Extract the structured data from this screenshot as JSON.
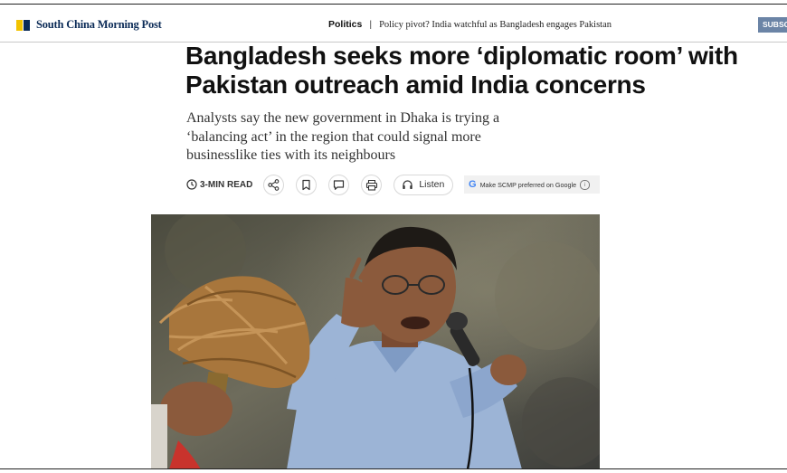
{
  "header": {
    "brand": "South China Morning Post",
    "section": "Politics",
    "separator": "|",
    "article_short_title": "Policy pivot? India watchful as Bangladesh engages Pakistan",
    "subscribe_label": "SUBSC"
  },
  "article": {
    "headline": "Bangladesh seeks more ‘diplomatic room’ with Pakistan outreach amid India concerns",
    "dek": "Analysts say the new government in Dhaka is trying a ‘balancing act’ in the region that could signal more businesslike ties with its neighbours"
  },
  "toolbar": {
    "read_time": "3-MIN READ",
    "listen_label": "Listen",
    "preferred_label": "Make SCMP preferred on Google",
    "info_glyph": "i",
    "google_glyph": "G",
    "icons": [
      "clock-icon",
      "share-icon",
      "bookmark-icon",
      "comment-icon",
      "print-icon",
      "headphones-icon",
      "google-icon",
      "info-icon"
    ]
  },
  "colors": {
    "brand_navy": "#0b2b57",
    "brand_yellow": "#f2c300",
    "subscribe_bg": "#6b84a6"
  }
}
